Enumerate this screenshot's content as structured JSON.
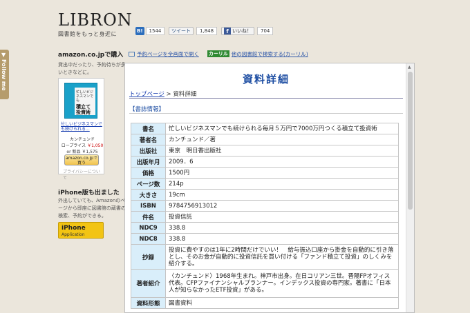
{
  "follow_tab": {
    "label": "Follow me"
  },
  "logo": {
    "name": "LIBRON",
    "tagline": "図書館をもっと身近に"
  },
  "social": {
    "hatena_label": "B!",
    "hatena_count": "1544",
    "tweet_label": "ツイート",
    "tweet_count": "1,848",
    "like_label": "いいね！",
    "like_count": "704"
  },
  "sidebar": {
    "amazon_heading": "amazon.co.jpで購入",
    "amazon_desc": "貸出中だったり、予約待ちが多いときなどに。",
    "ad": {
      "cover_small": "忙しいビジネスマンでも",
      "cover_big": "積立て投資術",
      "title": "忙しいビジネスマンでも続けられる...",
      "author": "カンチュンド",
      "price_label": "ロープライス",
      "price": "￥1,050",
      "new_label": "or 新品",
      "new_price": "￥1,575",
      "button": "amazon.co.jpで買う",
      "privacy": "プライバシーについて"
    },
    "iphone_heading": "iPhone版も出ました",
    "iphone_desc": "外出していても、Amazonのページから即座に図書館の蔵書の検索、予約ができる。",
    "app_badge": {
      "line1": "iPhone",
      "line2": "Application"
    }
  },
  "toplinks": {
    "fullscreen": "予約ページを全画面で開く",
    "calil_logo": "カーリル",
    "calil_search": "他の図書館で検索する(カーリル)"
  },
  "content": {
    "title": "資料詳細",
    "breadcrumb_top": "トップページ",
    "breadcrumb_sep": ">",
    "breadcrumb_current": "資料詳細",
    "section": "【書誌情報】",
    "rows": [
      {
        "key": "書名",
        "value": "忙しいビジネスマンでも続けられる毎月５万円で7000万円つくる積立て投資術"
      },
      {
        "key": "著者名",
        "value": "カンチュンド／著"
      },
      {
        "key": "出版社",
        "value": "東京　明日香出版社"
      },
      {
        "key": "出版年月",
        "value": "2009．6"
      },
      {
        "key": "価格",
        "value": "1500円"
      },
      {
        "key": "ページ数",
        "value": "214p"
      },
      {
        "key": "大きさ",
        "value": "19cm"
      },
      {
        "key": "ISBN",
        "value": "9784756913012"
      },
      {
        "key": "件名",
        "value": "投資信託"
      },
      {
        "key": "NDC9",
        "value": "338.8"
      },
      {
        "key": "NDC8",
        "value": "338.8"
      },
      {
        "key": "抄録",
        "value": "投資に費やすのは1年に2時間だけでいい！　給与振込口座から掛金を自動的に引き落とし、そのお金が自動的に投資信託を買い付ける「ファンド積立て投資」のしくみを紹介する。"
      },
      {
        "key": "著者紹介",
        "value": "〈カンチュンド〉1968年生まれ。神戸市出身。在日コリアン三世。晋陽FPオフィス代表。CFPファイナンシャルプランナー。インデックス投資の専門家。著書に「日本人が知らなかったETF投資」がある。"
      },
      {
        "key": "資料形態",
        "value": "図書資料"
      }
    ]
  }
}
